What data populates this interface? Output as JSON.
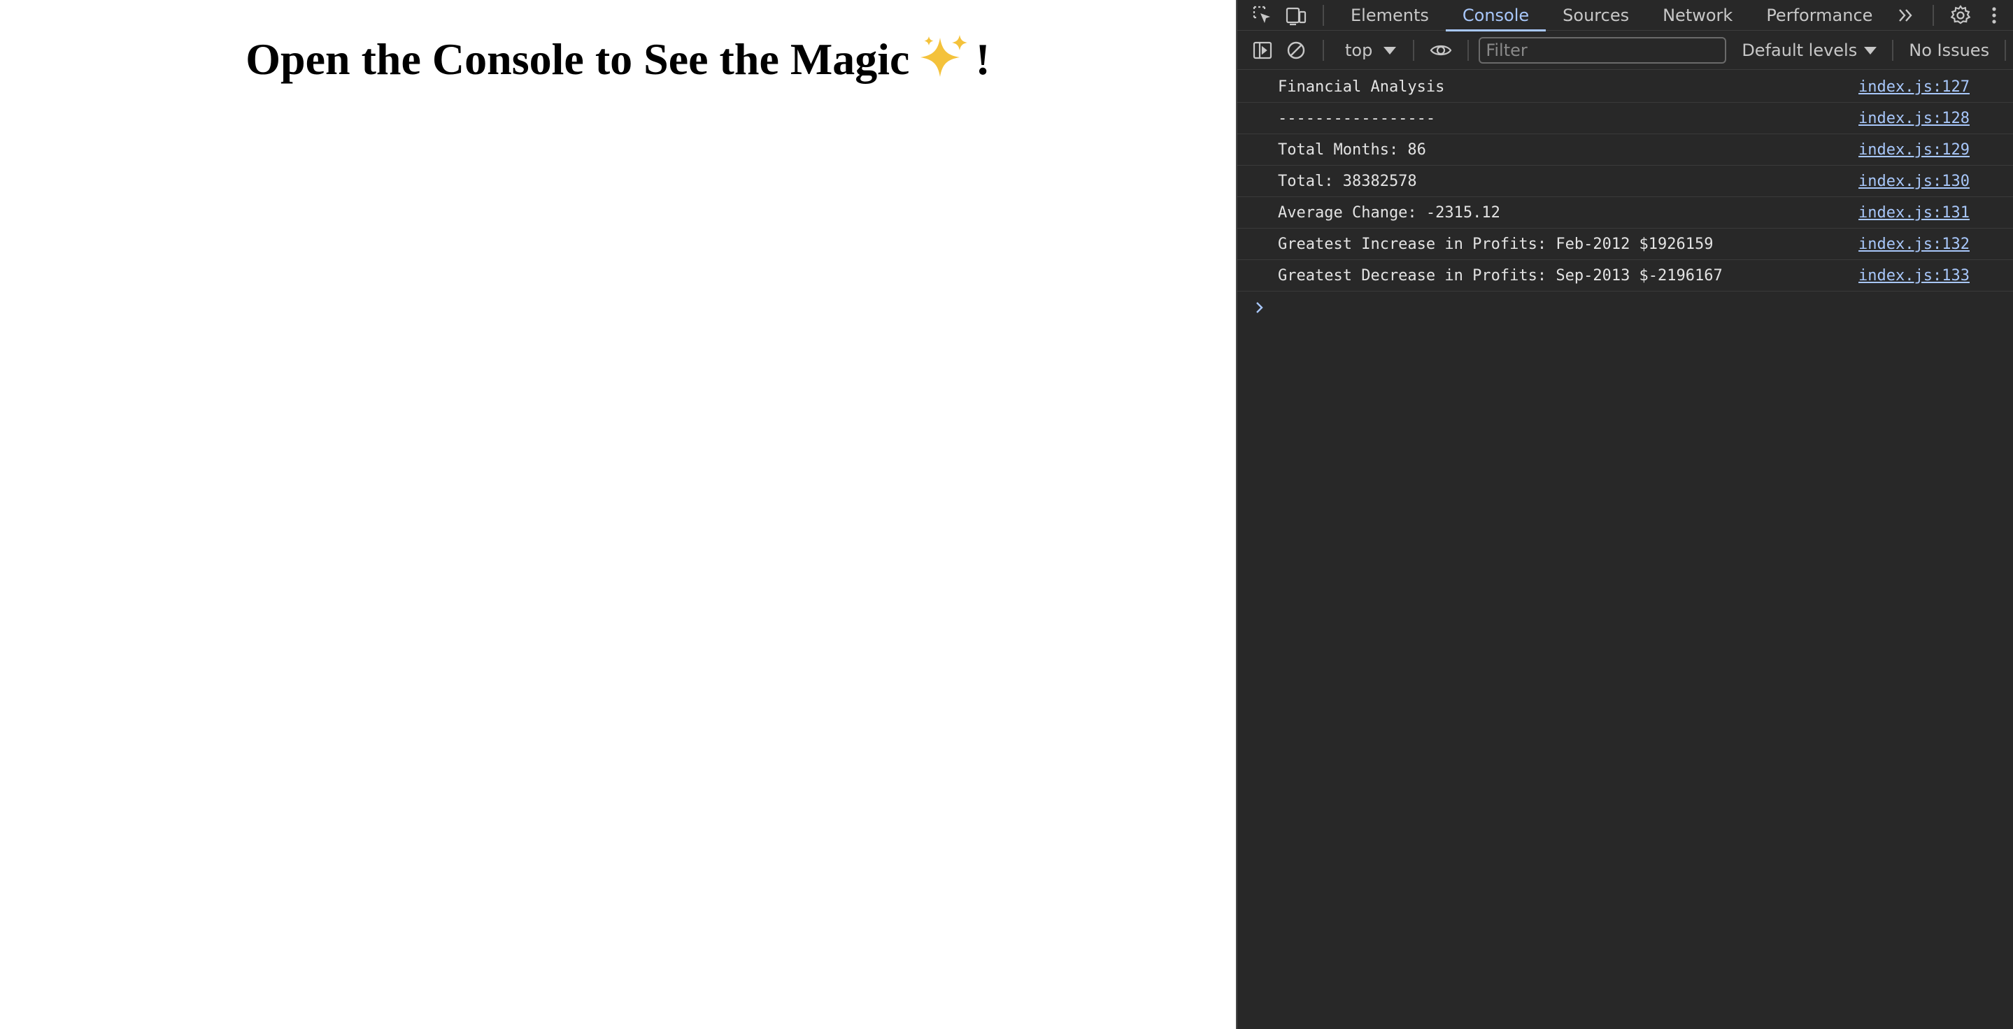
{
  "page": {
    "heading_text": "Open the Console to See the Magic",
    "heading_emoji": "sparkles-icon",
    "heading_suffix": "!"
  },
  "devtools": {
    "tabs": [
      {
        "label": "Elements",
        "active": false
      },
      {
        "label": "Console",
        "active": true
      },
      {
        "label": "Sources",
        "active": false
      },
      {
        "label": "Network",
        "active": false
      },
      {
        "label": "Performance",
        "active": false
      }
    ],
    "toolbar": {
      "context": "top",
      "filter_placeholder": "Filter",
      "levels": "Default levels",
      "issues": "No Issues"
    },
    "console": {
      "messages": [
        {
          "text": "Financial Analysis",
          "source": "index.js:127"
        },
        {
          "text": "-----------------",
          "source": "index.js:128"
        },
        {
          "text": "Total Months: 86",
          "source": "index.js:129"
        },
        {
          "text": "Total: 38382578",
          "source": "index.js:130"
        },
        {
          "text": "Average Change: -2315.12",
          "source": "index.js:131"
        },
        {
          "text": "Greatest Increase in Profits: Feb-2012 $1926159",
          "source": "index.js:132"
        },
        {
          "text": "Greatest Decrease in Profits: Sep-2013 $-2196167",
          "source": "index.js:133"
        }
      ]
    },
    "colors": {
      "panel_bg": "#282828",
      "accent": "#a8c7fa",
      "text": "#e3e3e3"
    }
  }
}
